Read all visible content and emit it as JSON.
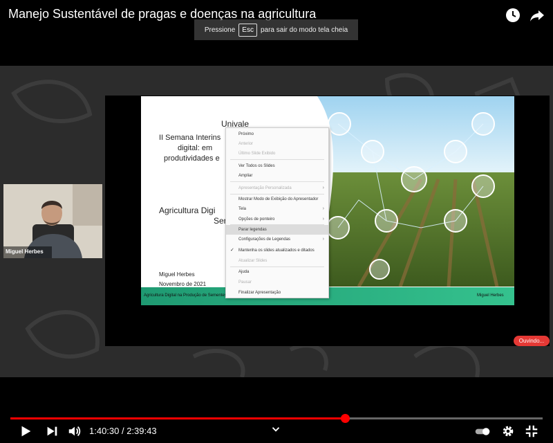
{
  "video": {
    "title": "Manejo Sustentável de pragas e doenças na agricultura",
    "esc_prefix": "Pressione",
    "esc_key": "Esc",
    "esc_suffix": "para sair do modo tela cheia"
  },
  "slide": {
    "heading": "Univale",
    "line1": "II Semana Interins",
    "line2": "digital: em",
    "line3": "produtividades e",
    "title_line1": "Agricultura Digi",
    "title_line2": "Ser",
    "author": "Miguel Herbes",
    "date": "Novembro de 2021",
    "footer_left": "Agricultura Digital na Produção de Sementes",
    "footer_right": "Miguel Herbes"
  },
  "context_menu": {
    "items": [
      {
        "label": "Próximo",
        "disabled": false
      },
      {
        "label": "Anterior",
        "disabled": true
      },
      {
        "label": "Último Slide Exibido",
        "disabled": true
      },
      {
        "label": "Ver Todos os Slides",
        "disabled": false
      },
      {
        "label": "Ampliar",
        "disabled": false
      },
      {
        "label": "Apresentação Personalizada",
        "disabled": true
      },
      {
        "label": "Mostrar Modo de Exibição do Apresentador",
        "disabled": false
      },
      {
        "label": "Tela",
        "disabled": false
      },
      {
        "label": "Opções de ponteiro",
        "disabled": false
      },
      {
        "label": "Parar legendas",
        "disabled": false
      },
      {
        "label": "Configurações de Legendas",
        "disabled": false
      },
      {
        "label": "Mantenha os slides atualizados e ditados",
        "disabled": false
      },
      {
        "label": "Atualizar Slides",
        "disabled": true
      },
      {
        "label": "Ajuda",
        "disabled": false
      },
      {
        "label": "Pausar",
        "disabled": true
      },
      {
        "label": "Finalizar Apresentação",
        "disabled": false
      }
    ]
  },
  "participant": {
    "name": "Miguel Herbes"
  },
  "status": {
    "listening": "Ouvindo..."
  },
  "player": {
    "current_time": "1:40:30",
    "duration": "2:39:43",
    "time_text": "1:40:30 / 2:39:43",
    "progress_fraction": 0.629,
    "accent": "#ff0000"
  },
  "icons": [
    "watch-later-icon",
    "share-icon",
    "play-icon",
    "next-icon",
    "volume-icon",
    "chevron-down-icon",
    "autoplay-toggle-icon",
    "settings-gear-icon",
    "exit-fullscreen-icon"
  ]
}
